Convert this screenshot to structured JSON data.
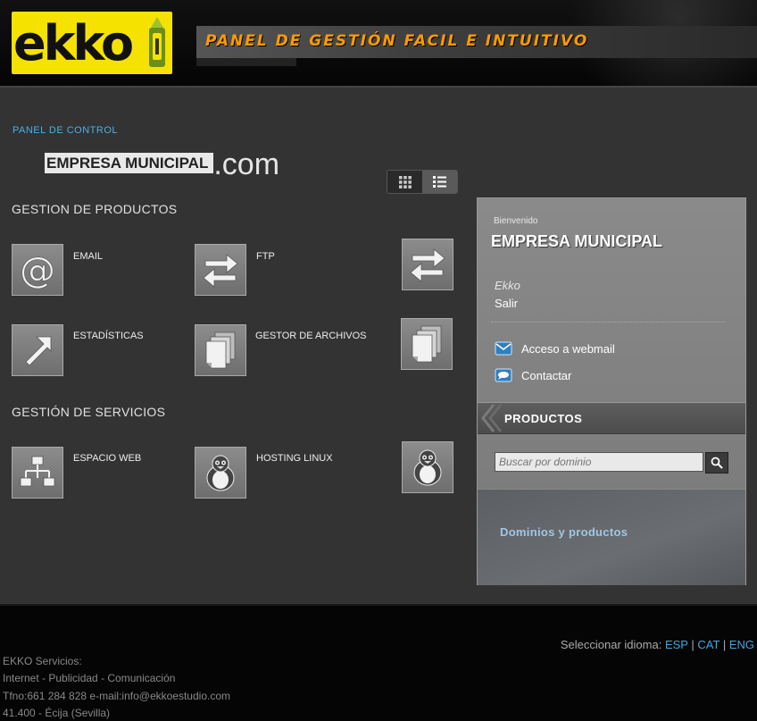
{
  "header": {
    "logo_text": "ekko",
    "slogan": "PANEL DE GESTIÓN FACIL E INTUITIVO"
  },
  "main": {
    "breadcrumb": "PANEL DE CONTROL",
    "domain_name": "EMPRESA  MUNICIPAL",
    "domain_tld": ".com",
    "sections": {
      "productos": "GESTION DE PRODUCTOS",
      "servicios": "GESTIÓN DE SERVICIOS"
    },
    "tiles": {
      "email": "EMAIL",
      "ftp": "FTP",
      "estadisticas": "ESTADÍSTICAS",
      "gestor": "GESTOR DE ARCHIVOS",
      "espacio": "ESPACIO WEB",
      "hosting": "HOSTING LINUX"
    }
  },
  "panel": {
    "welcome_small": "Bienvenido",
    "welcome_name": "EMPRESA  MUNICIPAL",
    "user": "Ekko",
    "logout": "Salir",
    "webmail": "Acceso a webmail",
    "contact": "Contactar",
    "products_header": "PRODUCTOS",
    "search_placeholder": "Buscar por dominio",
    "products_link": "Dominios y productos"
  },
  "footer": {
    "lang_label": "Seleccionar idioma:",
    "lang_esp": "ESP",
    "lang_cat": "CAT",
    "lang_eng": "ENG",
    "sep": "|",
    "line1": "EKKO Servicios:",
    "line2": "Internet - Publicidad - Comunicación",
    "line3": "Tfno:661 284 828 e-mail:info@ekkoestudio.com",
    "line4": "41.400 - Écija (Sevilla)"
  },
  "colors": {
    "accent_blue": "#4ab0e6",
    "slogan_orange": "#ff9a00",
    "logo_yellow": "#f5e200"
  }
}
